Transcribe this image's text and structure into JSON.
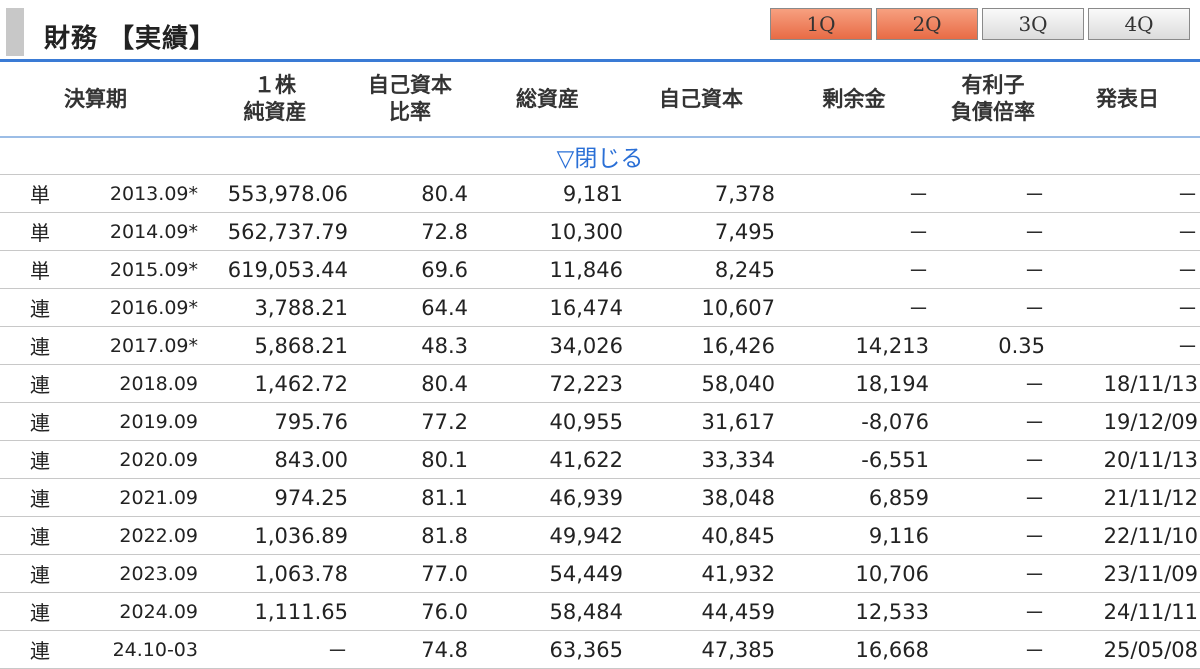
{
  "section": {
    "title": "財務 【実績】",
    "quarter_tabs": [
      {
        "label": "1Q",
        "active": true
      },
      {
        "label": "2Q",
        "active": true
      },
      {
        "label": "3Q",
        "active": false
      },
      {
        "label": "4Q",
        "active": false
      }
    ]
  },
  "table": {
    "headers": [
      "決算期",
      "１株\n純資産",
      "自己資本\n比率",
      "総資産",
      "自己資本",
      "剰余金",
      "有利子\n負債倍率",
      "発表日"
    ],
    "toggle_label": "▽閉じる",
    "rows": [
      {
        "type": "単",
        "period": "2013.09*",
        "bps": "553,978.06",
        "ratio": "80.4",
        "assets": "9,181",
        "equity": "7,378",
        "surplus": "－",
        "debt": "－",
        "date": "－"
      },
      {
        "type": "単",
        "period": "2014.09*",
        "bps": "562,737.79",
        "ratio": "72.8",
        "assets": "10,300",
        "equity": "7,495",
        "surplus": "－",
        "debt": "－",
        "date": "－"
      },
      {
        "type": "単",
        "period": "2015.09*",
        "bps": "619,053.44",
        "ratio": "69.6",
        "assets": "11,846",
        "equity": "8,245",
        "surplus": "－",
        "debt": "－",
        "date": "－"
      },
      {
        "type": "連",
        "period": "2016.09*",
        "bps": "3,788.21",
        "ratio": "64.4",
        "assets": "16,474",
        "equity": "10,607",
        "surplus": "－",
        "debt": "－",
        "date": "－"
      },
      {
        "type": "連",
        "period": "2017.09*",
        "bps": "5,868.21",
        "ratio": "48.3",
        "assets": "34,026",
        "equity": "16,426",
        "surplus": "14,213",
        "debt": "0.35",
        "date": "－"
      },
      {
        "type": "連",
        "period": "2018.09",
        "bps": "1,462.72",
        "ratio": "80.4",
        "assets": "72,223",
        "equity": "58,040",
        "surplus": "18,194",
        "debt": "－",
        "date": "18/11/13"
      },
      {
        "type": "連",
        "period": "2019.09",
        "bps": "795.76",
        "ratio": "77.2",
        "assets": "40,955",
        "equity": "31,617",
        "surplus": "-8,076",
        "debt": "－",
        "date": "19/12/09"
      },
      {
        "type": "連",
        "period": "2020.09",
        "bps": "843.00",
        "ratio": "80.1",
        "assets": "41,622",
        "equity": "33,334",
        "surplus": "-6,551",
        "debt": "－",
        "date": "20/11/13"
      },
      {
        "type": "連",
        "period": "2021.09",
        "bps": "974.25",
        "ratio": "81.1",
        "assets": "46,939",
        "equity": "38,048",
        "surplus": "6,859",
        "debt": "－",
        "date": "21/11/12"
      },
      {
        "type": "連",
        "period": "2022.09",
        "bps": "1,036.89",
        "ratio": "81.8",
        "assets": "49,942",
        "equity": "40,845",
        "surplus": "9,116",
        "debt": "－",
        "date": "22/11/10"
      },
      {
        "type": "連",
        "period": "2023.09",
        "bps": "1,063.78",
        "ratio": "77.0",
        "assets": "54,449",
        "equity": "41,932",
        "surplus": "10,706",
        "debt": "－",
        "date": "23/11/09"
      },
      {
        "type": "連",
        "period": "2024.09",
        "bps": "1,111.65",
        "ratio": "76.0",
        "assets": "58,484",
        "equity": "44,459",
        "surplus": "12,533",
        "debt": "－",
        "date": "24/11/11"
      },
      {
        "type": "連",
        "period": "24.10-03",
        "bps": "－",
        "ratio": "74.8",
        "assets": "63,365",
        "equity": "47,385",
        "surplus": "16,668",
        "debt": "－",
        "date": "25/05/08"
      }
    ]
  }
}
